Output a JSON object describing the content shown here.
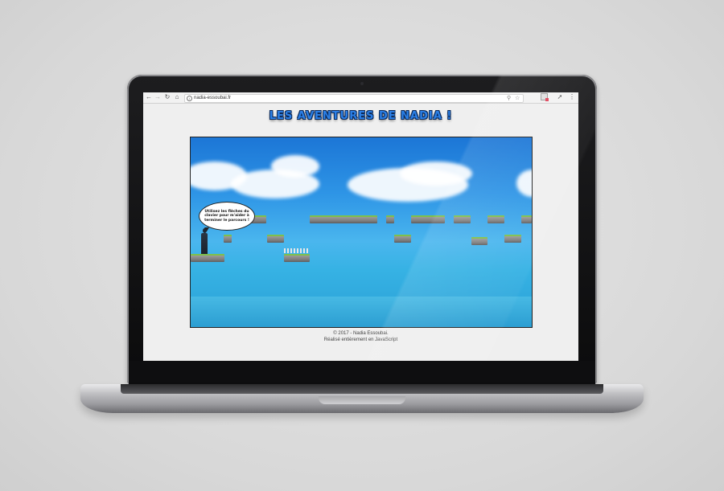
{
  "browser": {
    "url": "nadia-essoubai.fr",
    "nav_icons": [
      "back-arrow-icon",
      "forward-arrow-icon",
      "reload-icon",
      "home-icon"
    ],
    "toolbar_icons": [
      "zoom-icon",
      "bookmark-star-icon",
      "extension-icon",
      "extension-icon",
      "menu-icon"
    ]
  },
  "page": {
    "title": "LES AVENTURES DE NADIA !",
    "title_color": "#2b7fe6"
  },
  "game": {
    "speech_bubble": "Utilisez les flèches du clavier pour m'aider à terminer le parcours !"
  },
  "footer": {
    "line1": "© 2017 - Nadia Essoubai.",
    "line2": "Réalisé entièrement en JavaScript"
  }
}
